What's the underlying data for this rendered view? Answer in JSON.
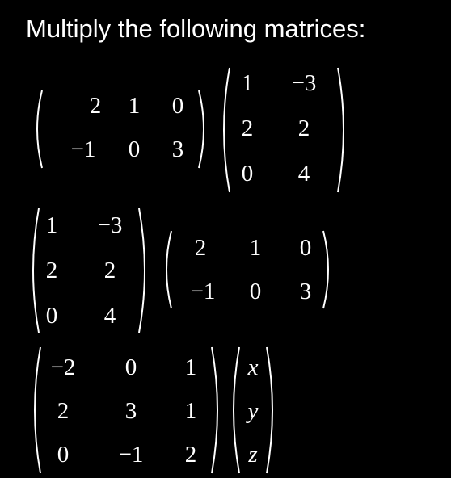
{
  "title": "Multiply the following matrices:",
  "problems": [
    {
      "left": {
        "rows": [
          [
            "2",
            "1",
            "0"
          ],
          [
            "−1",
            "0",
            "3"
          ]
        ]
      },
      "right": {
        "rows": [
          [
            "1",
            "−3"
          ],
          [
            "2",
            "2"
          ],
          [
            "0",
            "4"
          ]
        ]
      }
    },
    {
      "left": {
        "rows": [
          [
            "1",
            "−3"
          ],
          [
            "2",
            "2"
          ],
          [
            "0",
            "4"
          ]
        ]
      },
      "right": {
        "rows": [
          [
            "2",
            "1",
            "0"
          ],
          [
            "−1",
            "0",
            "3"
          ]
        ]
      }
    },
    {
      "left": {
        "rows": [
          [
            "−2",
            "0",
            "1"
          ],
          [
            "2",
            "3",
            "1"
          ],
          [
            "0",
            "−1",
            "2"
          ]
        ]
      },
      "right": {
        "rows": [
          [
            "x"
          ],
          [
            "y"
          ],
          [
            "z"
          ]
        ]
      }
    }
  ]
}
